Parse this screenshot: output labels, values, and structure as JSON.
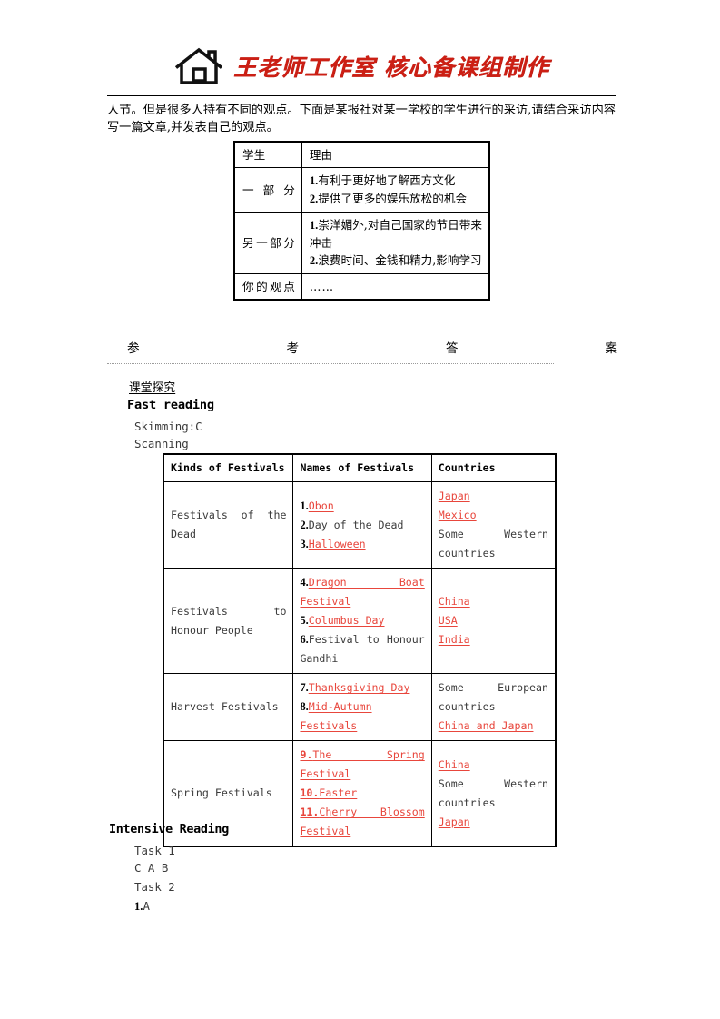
{
  "header": {
    "icon": "house-icon",
    "logo_text": "王老师工作室 核心备课组制作",
    "logo_color": "#cc1f14"
  },
  "intro": {
    "paragraph": "人节。但是很多人持有不同的观点。下面是某报社对某一学校的学生进行的采访,请结合采访内容写一篇文章,并发表自己的观点。"
  },
  "interview_table": {
    "headers": [
      "学生",
      "理由"
    ],
    "rows": [
      {
        "student": "一部分",
        "reasons": [
          {
            "num": "1.",
            "text": "有利于更好地了解西方文化"
          },
          {
            "num": "2.",
            "text": "提供了更多的娱乐放松的机会"
          }
        ]
      },
      {
        "student": "另一部分",
        "reasons": [
          {
            "num": "1.",
            "text": "崇洋媚外,对自己国家的节日带来冲击"
          },
          {
            "num": "2.",
            "text": "浪费时间、金钱和精力,影响学习"
          }
        ]
      },
      {
        "student": "你的观点",
        "reasons": [
          {
            "num": "",
            "text": "……"
          }
        ]
      }
    ]
  },
  "answer_section": {
    "title": "参考答案",
    "subsection_label": "课堂探究",
    "fast_reading_heading": "Fast reading",
    "skimming": "Skimming:C",
    "scanning": "Scanning"
  },
  "festivals_table": {
    "headers": [
      "Kinds of Festivals",
      "Names of Festivals",
      "Countries"
    ],
    "rows": [
      {
        "kind": "Festivals of the Dead",
        "names": [
          {
            "num": "1.",
            "text": "Obon",
            "answer": true
          },
          {
            "num": "2.",
            "text": "Day of the Dead",
            "answer": false
          },
          {
            "num": "3.",
            "text": "Halloween",
            "answer": true
          }
        ],
        "countries": [
          {
            "text": "Japan",
            "answer": true
          },
          {
            "text": "Mexico",
            "answer": true
          },
          {
            "text": "Some Western countries",
            "answer": false
          }
        ]
      },
      {
        "kind": "Festivals to Honour People",
        "names": [
          {
            "num": "4.",
            "text": "Dragon Boat Festival",
            "answer": true
          },
          {
            "num": "5.",
            "text": "Columbus Day",
            "answer": true
          },
          {
            "num": "6.",
            "text": "Festival to Honour Gandhi",
            "answer": false
          }
        ],
        "countries": [
          {
            "text": "China",
            "answer": true
          },
          {
            "text": "USA",
            "answer": true
          },
          {
            "text": "India",
            "answer": true
          }
        ]
      },
      {
        "kind": "Harvest Festivals",
        "names": [
          {
            "num": "7.",
            "text": "Thanksgiving Day",
            "answer": true
          },
          {
            "num": "8.",
            "text": "Mid-Autumn Festivals",
            "answer": true
          }
        ],
        "countries": [
          {
            "text": "Some European countries",
            "answer": false
          },
          {
            "text": "China and Japan",
            "answer": true
          }
        ]
      },
      {
        "kind": "Spring Festivals",
        "names": [
          {
            "num": "9.",
            "text": "The Spring Festival",
            "answer": true
          },
          {
            "num": "10.",
            "text": "Easter",
            "answer": true
          },
          {
            "num": "11.",
            "text": "Cherry Blossom Festival",
            "answer": true
          }
        ],
        "countries": [
          {
            "text": "China",
            "answer": true
          },
          {
            "text": "Some Western countries",
            "answer": false
          },
          {
            "text": "Japan",
            "answer": true
          }
        ]
      }
    ]
  },
  "intensive_reading": {
    "heading": "Intensive Reading",
    "task1_label": "Task 1",
    "task1_answers": "C  A  B",
    "task2_label": "Task 2",
    "task2_num": "1.",
    "task2_answer": "A"
  }
}
